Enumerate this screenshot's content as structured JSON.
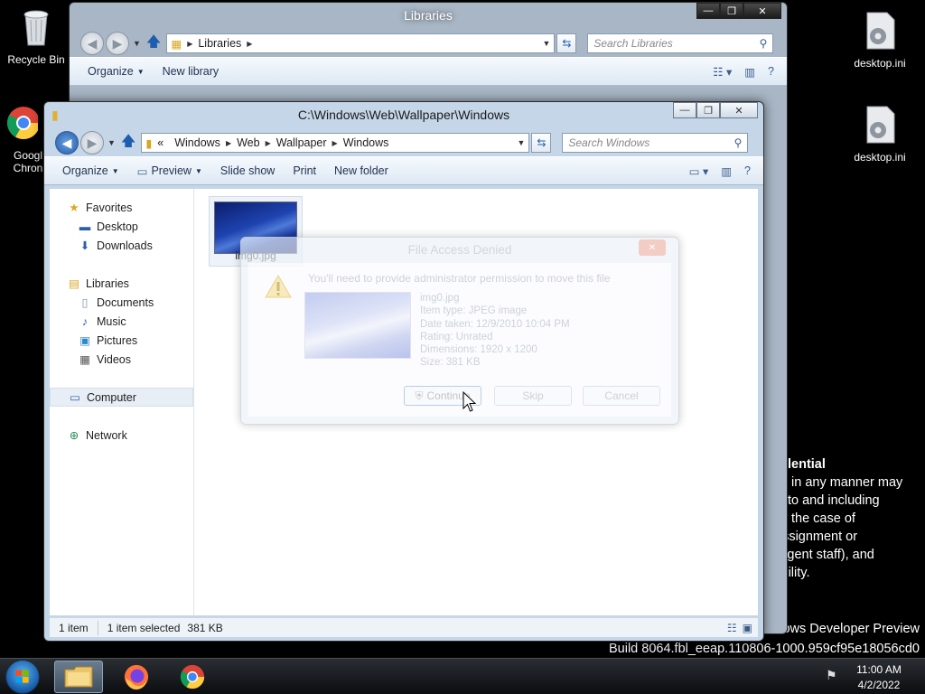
{
  "desktop": {
    "icons": [
      {
        "label": "Recycle Bin"
      },
      {
        "label": "desktop.ini"
      },
      {
        "label": "desktop.ini"
      },
      {
        "label": "Googl\nChron"
      }
    ],
    "confidential_lines": [
      "lential",
      "in any manner may",
      "to and including",
      "the case of",
      "assignment or",
      "ntingent staff), and",
      "liability."
    ],
    "build_line1": "ndows Developer Preview",
    "build_line2": "Build 8064.fbl_eeap.110806-1000.959cf95e18056cd0"
  },
  "libraries_window": {
    "title": "Libraries",
    "address": [
      "Libraries"
    ],
    "search_placeholder": "Search Libraries",
    "commands": {
      "organize": "Organize",
      "new_library": "New library"
    }
  },
  "explorer": {
    "title": "C:\\Windows\\Web\\Wallpaper\\Windows",
    "address_prefix": "«",
    "address": [
      "Windows",
      "Web",
      "Wallpaper",
      "Windows"
    ],
    "search_placeholder": "Search Windows",
    "commands": {
      "organize": "Organize",
      "preview": "Preview",
      "slideshow": "Slide show",
      "print": "Print",
      "new_folder": "New folder"
    },
    "nav": {
      "favorites": "Favorites",
      "desktop": "Desktop",
      "downloads": "Downloads",
      "libraries": "Libraries",
      "documents": "Documents",
      "music": "Music",
      "pictures": "Pictures",
      "videos": "Videos",
      "computer": "Computer",
      "network": "Network"
    },
    "file": {
      "name": "img0.jpg"
    },
    "status": {
      "count": "1 item",
      "selected": "1 item selected",
      "size": "381 KB"
    }
  },
  "dialog": {
    "title": "File Access Denied",
    "message": "You'll need to provide administrator permission to move this file",
    "file_name": "img0.jpg",
    "item_type": "Item type: JPEG image",
    "date_taken": "Date taken: 12/9/2010 10:04 PM",
    "rating": "Rating: Unrated",
    "dimensions": "Dimensions: 1920 x 1200",
    "size": "Size: 381 KB",
    "buttons": {
      "continue": "Continue",
      "skip": "Skip",
      "cancel": "Cancel"
    }
  },
  "taskbar": {
    "time": "11:00 AM",
    "date": "4/2/2022"
  }
}
